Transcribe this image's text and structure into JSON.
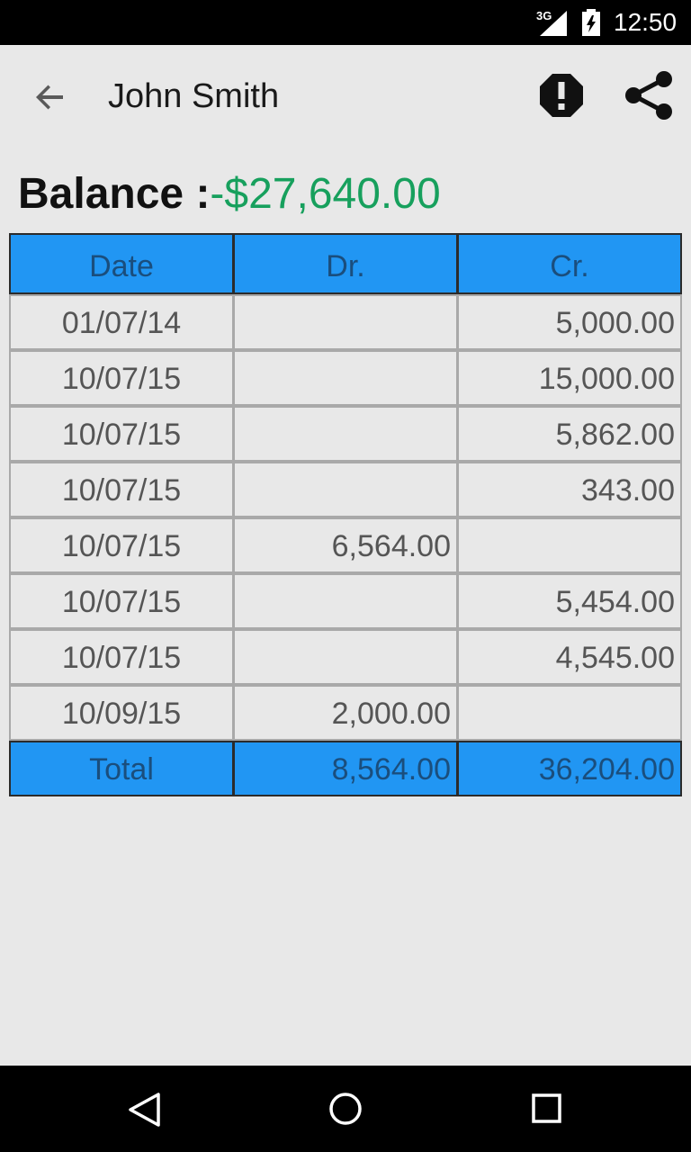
{
  "status_bar": {
    "network": "3G",
    "time": "12:50"
  },
  "app_bar": {
    "title": "John Smith",
    "icons": [
      "back-arrow-icon",
      "alert-icon",
      "share-icon"
    ]
  },
  "balance": {
    "label": "Balance :",
    "value": "-$27,640.00",
    "value_color": "#17a05d"
  },
  "table": {
    "header_color": "#2196f3",
    "columns": [
      "Date",
      "Dr.",
      "Cr."
    ],
    "rows": [
      {
        "date": "01/07/14",
        "dr": "",
        "cr": "5,000.00"
      },
      {
        "date": "10/07/15",
        "dr": "",
        "cr": "15,000.00"
      },
      {
        "date": "10/07/15",
        "dr": "",
        "cr": "5,862.00"
      },
      {
        "date": "10/07/15",
        "dr": "",
        "cr": "343.00"
      },
      {
        "date": "10/07/15",
        "dr": "6,564.00",
        "cr": ""
      },
      {
        "date": "10/07/15",
        "dr": "",
        "cr": "5,454.00"
      },
      {
        "date": "10/07/15",
        "dr": "",
        "cr": "4,545.00"
      },
      {
        "date": "10/09/15",
        "dr": "2,000.00",
        "cr": ""
      }
    ],
    "total": {
      "label": "Total",
      "dr": "8,564.00",
      "cr": "36,204.00"
    }
  },
  "nav_bar": {
    "icons": [
      "nav-back-icon",
      "nav-home-icon",
      "nav-recents-icon"
    ]
  }
}
